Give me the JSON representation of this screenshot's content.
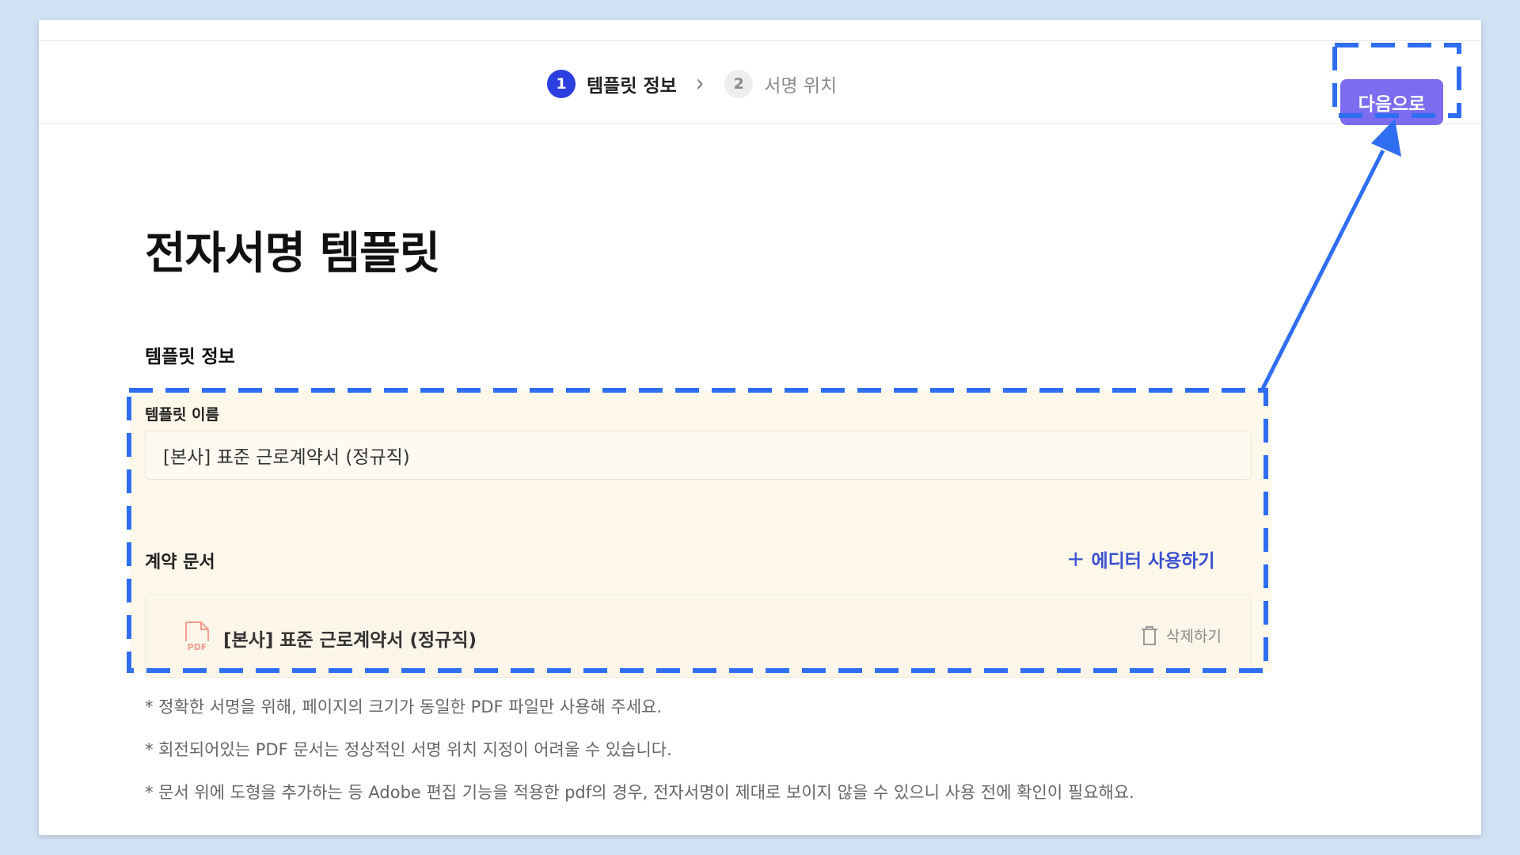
{
  "header": {
    "steps": [
      {
        "number": "1",
        "label": "템플릿 정보"
      },
      {
        "number": "2",
        "label": "서명 위치"
      }
    ],
    "next_label": "다음으로"
  },
  "page": {
    "title": "전자서명 템플릿",
    "section_title": "템플릿 정보"
  },
  "form": {
    "name_label": "템플릿 이름",
    "name_value": "[본사] 표준 근로계약서 (정규직)",
    "doc_label": "계약 문서",
    "editor_link": "에디터 사용하기",
    "document": {
      "file_type": "PDF",
      "name": "[본사] 표준 근로계약서 (정규직)",
      "delete_label": "삭제하기"
    }
  },
  "notes": [
    "* 정확한 서명을 위해, 페이지의 크기가 동일한 PDF 파일만 사용해 주세요.",
    "* 회전되어있는 PDF 문서는 정상적인 서명 위치 지정이 어려울 수 있습니다.",
    "* 문서 위에 도형을 추가하는 등 Adobe 편집 기능을 적용한 pdf의 경우, 전자서명이 제대로 보이지 않을 수 있으니 사용 전에 확인이 필요해요."
  ],
  "colors": {
    "accent": "#2b3fe0",
    "next_button": "#7b6cf0",
    "annotation": "#2f6ef0",
    "highlight_bg": "#fdf8ea",
    "page_bg": "#cfe1f3"
  }
}
